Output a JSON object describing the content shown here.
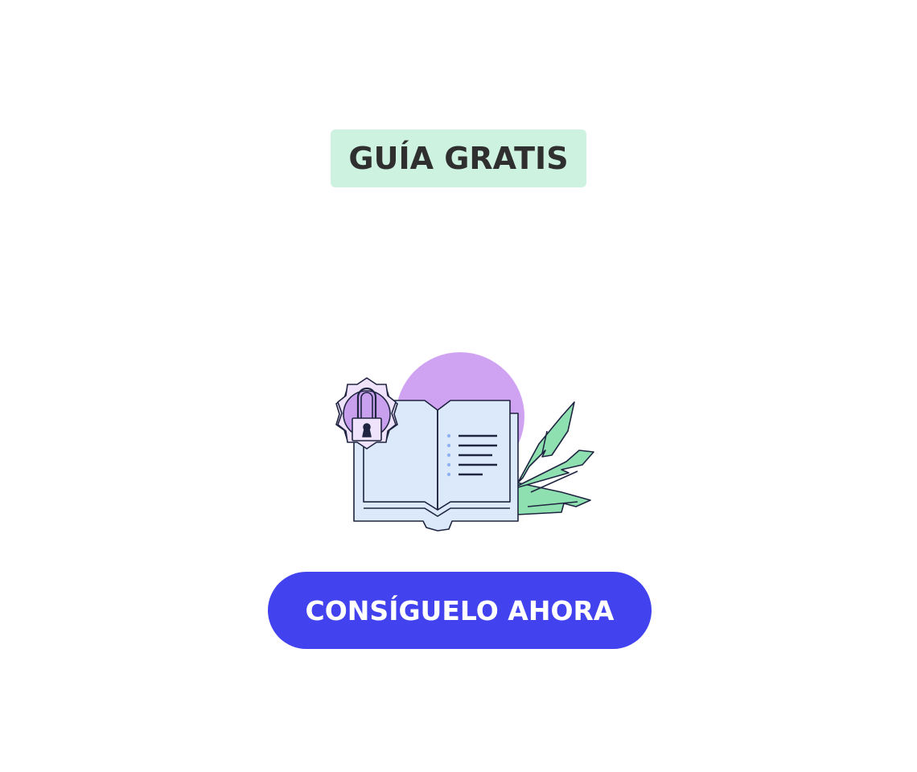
{
  "badge": {
    "label": "GUÍA GRATIS",
    "background": "#cdf2e0",
    "text_color": "#2f2f2f"
  },
  "illustration": {
    "icons": [
      "gear-lock-icon",
      "open-book-icon",
      "leaves-icon",
      "circle-backdrop"
    ],
    "colors": {
      "circle": "#d0a3f2",
      "gear": "#efe3fb",
      "lock_circle": "#c9a0ee",
      "book": "#dce9fb",
      "leaves": "#8fe0b0",
      "outline": "#1f2540",
      "dots": "#8fb3f0"
    }
  },
  "cta": {
    "label": "CONSÍGUELO AHORA",
    "background": "#4342ef",
    "text_color": "#ffffff"
  }
}
